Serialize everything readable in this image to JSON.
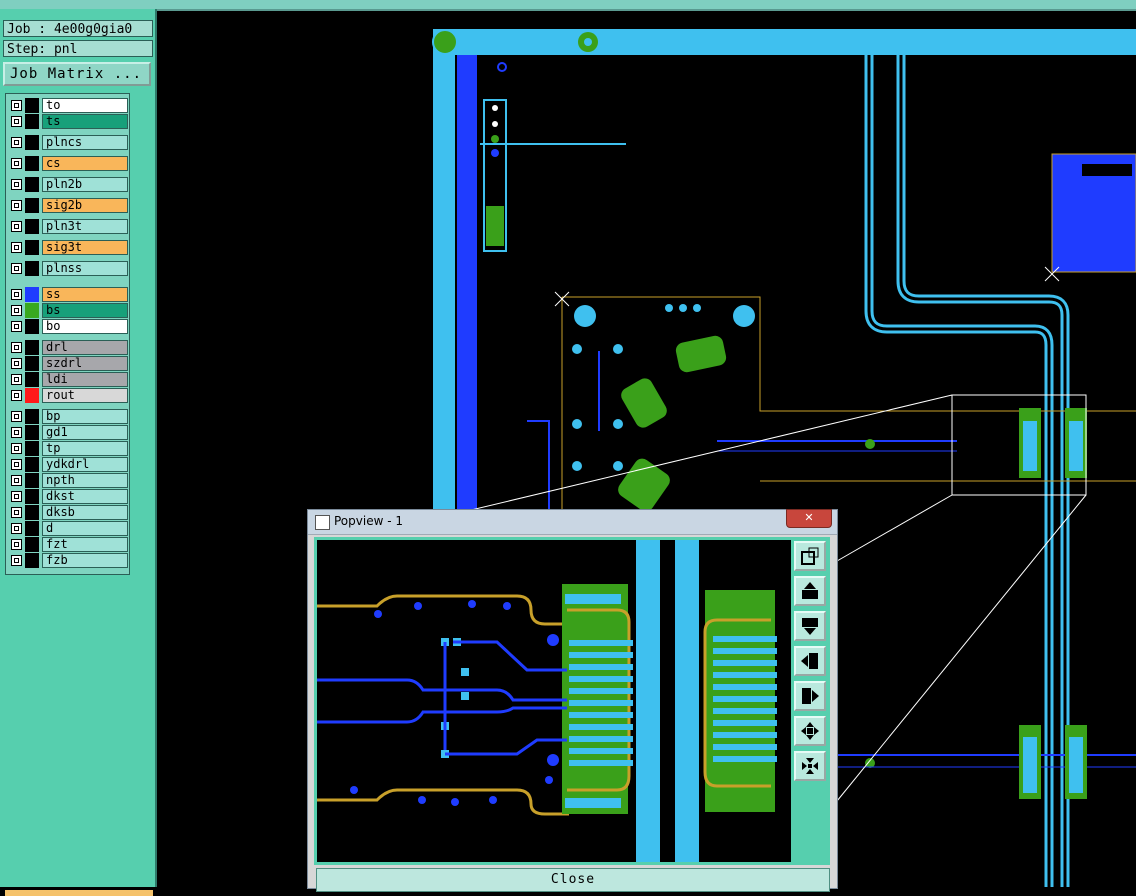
{
  "job": {
    "job_label": "Job : 4e00g0gia0",
    "step_label": "Step: pnl",
    "matrix_button": "Job Matrix ..."
  },
  "layers": [
    {
      "name": "to",
      "color": "#ffffff",
      "swatch": "#000000"
    },
    {
      "name": "ts",
      "color": "#17a07a",
      "swatch": "#000000"
    },
    {
      "name": "plncs",
      "color": "#9fe1d7",
      "swatch": "#000000"
    },
    {
      "name": "cs",
      "color": "#f9b65a",
      "swatch": "#000000"
    },
    {
      "name": "pln2b",
      "color": "#9fe1d7",
      "swatch": "#000000"
    },
    {
      "name": "sig2b",
      "color": "#f9b65a",
      "swatch": "#000000"
    },
    {
      "name": "pln3t",
      "color": "#9fe1d7",
      "swatch": "#000000"
    },
    {
      "name": "sig3t",
      "color": "#f9b65a",
      "swatch": "#000000"
    },
    {
      "name": "plnss",
      "color": "#9fe1d7",
      "swatch": "#000000"
    },
    {
      "name": "ss",
      "color": "#f9b65a",
      "swatch": "#1f3cff"
    },
    {
      "name": "bs",
      "color": "#17a07a",
      "swatch": "#38a81f"
    },
    {
      "name": "bo",
      "color": "#ffffff",
      "swatch": "#000000"
    },
    {
      "name": "drl",
      "color": "#a7a7ab",
      "swatch": "#000000"
    },
    {
      "name": "szdrl",
      "color": "#a7a7ab",
      "swatch": "#000000"
    },
    {
      "name": "ldi",
      "color": "#a7a7ab",
      "swatch": "#000000"
    },
    {
      "name": "rout",
      "color": "#d8d8d8",
      "swatch": "#ff1a1a"
    },
    {
      "name": "bp",
      "color": "#9fe1d7",
      "swatch": "#000000"
    },
    {
      "name": "gd1",
      "color": "#9fe1d7",
      "swatch": "#000000"
    },
    {
      "name": "tp",
      "color": "#9fe1d7",
      "swatch": "#000000"
    },
    {
      "name": "ydkdrl",
      "color": "#9fe1d7",
      "swatch": "#000000"
    },
    {
      "name": "npth",
      "color": "#9fe1d7",
      "swatch": "#000000"
    },
    {
      "name": "dkst",
      "color": "#9fe1d7",
      "swatch": "#000000"
    },
    {
      "name": "dksb",
      "color": "#9fe1d7",
      "swatch": "#000000"
    },
    {
      "name": "d",
      "color": "#9fe1d7",
      "swatch": "#000000"
    },
    {
      "name": "fzt",
      "color": "#9fe1d7",
      "swatch": "#000000"
    },
    {
      "name": "fzb",
      "color": "#9fe1d7",
      "swatch": "#000000"
    }
  ],
  "popview": {
    "title": "Popview - 1",
    "close_label": "Close"
  },
  "colors": {
    "panel": "#56cfae",
    "trace_blue": "#1f3cff",
    "copper_cyan": "#3fc0ef",
    "pad_green": "#3aa01a",
    "outline_gold": "#c8a02a"
  }
}
